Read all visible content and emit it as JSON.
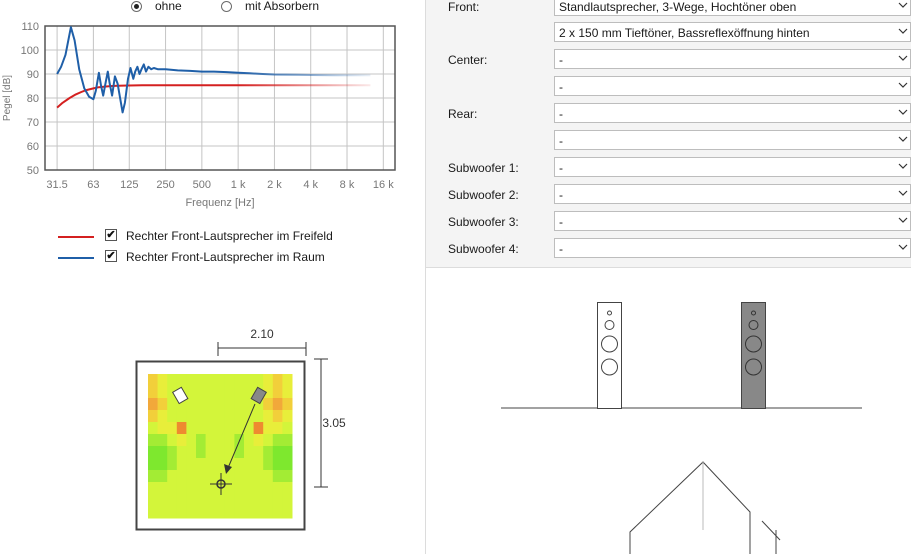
{
  "measurement": {
    "options": [
      {
        "label": "ohne",
        "selected": true
      },
      {
        "label": "mit Absorbern",
        "selected": false
      }
    ]
  },
  "chart_data": {
    "type": "line",
    "title": "",
    "xlabel": "Frequenz [Hz]",
    "ylabel": "Pegel [dB]",
    "xscale": "log",
    "xlim": [
      25,
      20000
    ],
    "ylim": [
      50,
      110
    ],
    "grid": true,
    "x_ticks": [
      "31.5",
      "63",
      "125",
      "250",
      "500",
      "1 k",
      "2 k",
      "4 k",
      "8 k",
      "16 k"
    ],
    "y_ticks": [
      "50",
      "60",
      "70",
      "80",
      "90",
      "100",
      "110"
    ],
    "series": [
      {
        "name": "Rechter Front-Lautsprecher im Freifeld",
        "color": "#d42020",
        "x": [
          31.5,
          35,
          40,
          45,
          50,
          55,
          63,
          70,
          80,
          90,
          100,
          125,
          160,
          200,
          250,
          315,
          400,
          500,
          630,
          800,
          1000,
          1250,
          1600,
          2000,
          3150,
          4000,
          6300,
          8000,
          12500
        ],
        "y": [
          76,
          78,
          80,
          81.5,
          82.5,
          83.3,
          84,
          84.5,
          84.8,
          85,
          85.1,
          85.2,
          85.3,
          85.3,
          85.3,
          85.3,
          85.3,
          85.3,
          85.3,
          85.3,
          85.3,
          85.3,
          85.3,
          85.3,
          85.3,
          85.3,
          85.3,
          85.3,
          85.3
        ]
      },
      {
        "name": "Rechter Front-Lautsprecher im Raum",
        "color": "#1f5fa8",
        "x": [
          31.5,
          34,
          37,
          39,
          41,
          44,
          48,
          53,
          58,
          63,
          66,
          70,
          73,
          76,
          80,
          83,
          86,
          90,
          95,
          100,
          105,
          110,
          115,
          122,
          128,
          135,
          140,
          146,
          152,
          158,
          165,
          172,
          180,
          190,
          200,
          215,
          250,
          315,
          400,
          500,
          630,
          800,
          1000,
          1250,
          1600,
          2000,
          3150,
          4000,
          6300,
          8000,
          12500
        ],
        "y": [
          90,
          93,
          98,
          104,
          109.5,
          104,
          92,
          84,
          80.5,
          79.5,
          83,
          90.5,
          85,
          81,
          87,
          91,
          86,
          81,
          89,
          86,
          80,
          74,
          78,
          88,
          92.5,
          88,
          91,
          93,
          90,
          92,
          94,
          91,
          93,
          92,
          92.5,
          92,
          92,
          91.5,
          91.3,
          91,
          91,
          90.8,
          90.5,
          90.3,
          90,
          89.8,
          89.7,
          89.6,
          89.5,
          89.5,
          89.5
        ]
      }
    ]
  },
  "legend": [
    {
      "label": "Rechter Front-Lautsprecher im Freifeld",
      "color": "#d42020",
      "checked": true
    },
    {
      "label": "Rechter Front-Lautsprecher im Raum",
      "color": "#1f5fa8",
      "checked": true
    }
  ],
  "room": {
    "width_label": "2.10",
    "depth_label": "3.05",
    "heatmap": [
      [
        2,
        1,
        0,
        0,
        0,
        0,
        0,
        0,
        0,
        0,
        0,
        0,
        1,
        2,
        1
      ],
      [
        2,
        1,
        0,
        0,
        0,
        0,
        0,
        0,
        0,
        0,
        0,
        0,
        1,
        2,
        1
      ],
      [
        3,
        2,
        0,
        0,
        0,
        0,
        0,
        0,
        0,
        0,
        0,
        0,
        2,
        3,
        2
      ],
      [
        2,
        1,
        0,
        0,
        0,
        0,
        0,
        0,
        0,
        0,
        0,
        0,
        1,
        2,
        1
      ],
      [
        0,
        1,
        1,
        4,
        0,
        0,
        0,
        0,
        0,
        0,
        0,
        4,
        1,
        1,
        0
      ],
      [
        -1,
        -1,
        0,
        1,
        0,
        -1,
        0,
        0,
        0,
        -1,
        0,
        1,
        0,
        -1,
        -1
      ],
      [
        -2,
        -2,
        -1,
        0,
        0,
        -1,
        0,
        0,
        0,
        -1,
        0,
        0,
        -1,
        -2,
        -2
      ],
      [
        -2,
        -2,
        -1,
        0,
        0,
        0,
        0,
        0,
        0,
        0,
        0,
        0,
        -1,
        -2,
        -2
      ],
      [
        -1,
        -1,
        0,
        0,
        0,
        0,
        0,
        0,
        0,
        0,
        0,
        0,
        0,
        -1,
        -1
      ],
      [
        0,
        0,
        0,
        0,
        0,
        0,
        0,
        0,
        0,
        0,
        0,
        0,
        0,
        0,
        0
      ],
      [
        0,
        0,
        0,
        0,
        0,
        0,
        0,
        0,
        0,
        0,
        0,
        0,
        0,
        0,
        0
      ],
      [
        0,
        0,
        0,
        0,
        0,
        0,
        0,
        0,
        0,
        0,
        0,
        0,
        0,
        0,
        0
      ]
    ]
  },
  "speaker_config": {
    "rows": [
      {
        "label": "Front:",
        "value": "Standlautsprecher, 3-Wege, Hochtöner oben"
      },
      {
        "label": "",
        "value": "2 x 150 mm Tieftöner, Bassreflexöffnung hinten"
      },
      {
        "label": "Center:",
        "value": "-"
      },
      {
        "label": "",
        "value": "-"
      },
      {
        "label": "Rear:",
        "value": "-"
      },
      {
        "label": "",
        "value": "-"
      },
      {
        "label": "Subwoofer 1:",
        "value": "-"
      },
      {
        "label": "Subwoofer 2:",
        "value": "-"
      },
      {
        "label": "Subwoofer 3:",
        "value": "-"
      },
      {
        "label": "Subwoofer 4:",
        "value": "-"
      }
    ]
  }
}
